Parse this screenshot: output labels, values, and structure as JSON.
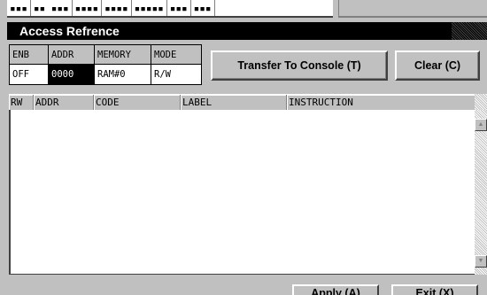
{
  "top_row": {
    "cells": [
      "▪▪▪",
      "▪▪ ▪▪▪",
      "▪▪▪▪",
      "▪▪▪▪",
      "▪▪▪▪▪",
      "▪▪▪",
      "▪▪▪"
    ]
  },
  "group": {
    "title": "Access Refrence"
  },
  "access_table": {
    "headers": [
      "ENB",
      "ADDR",
      "MEMORY",
      "MODE"
    ],
    "values": [
      "OFF",
      "0000",
      "RAM#0",
      "R/W"
    ]
  },
  "buttons": {
    "transfer_label": "Transfer To Console (T)",
    "clear_label": "Clear (C)",
    "apply_label": "Apply (A)",
    "exit_label": "Exit (X)"
  },
  "listing": {
    "columns": [
      "RW",
      "ADDR",
      "CODE",
      "LABEL",
      "INSTRUCTION"
    ],
    "rows": []
  },
  "scrollbar": {
    "up_icon": "arrow-up-icon",
    "down_icon": "arrow-down-icon"
  }
}
